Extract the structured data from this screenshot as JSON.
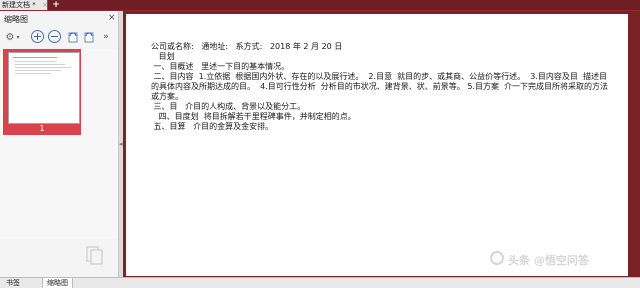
{
  "window": {
    "tab_title": "新建文档 *",
    "tab_close": "×",
    "new_tab": "+"
  },
  "left_panel": {
    "title": "缩略图",
    "close": "×",
    "toolbar": {
      "settings": "⚙",
      "zoom_in": "+",
      "zoom_out": "−",
      "more": "»"
    },
    "thumbnail": {
      "page_label": "1"
    }
  },
  "bottom_tabs": [
    {
      "label": "书签"
    },
    {
      "label": "缩略图"
    }
  ],
  "document": {
    "lines": [
      "公司或名称:   通地址:   系方式:   2018 年 2 月 20 日",
      "   目划",
      " 一、目概述   里述一下目的基本情况。",
      " 二、目内容  1.立依据  根据国内外状、存在的以及展行述。  2.目意  就目的步、或其商、公益价等行述。  3.目内容及目  描述目的具体内容及所期达成的目。  4.目可行性分析  分析目的市状况、建背景、状、前景等。 5.目方案  介一下完成目所将采取的方法或方案。",
      " 三、目   介目的人构成、背景以及能分工。",
      "   四、目度划  将目拆解若干里程碑事件，并制定相的点。",
      " 五、目算   介目的金算及金安排。"
    ]
  },
  "watermark": "头条 @悟空问答"
}
